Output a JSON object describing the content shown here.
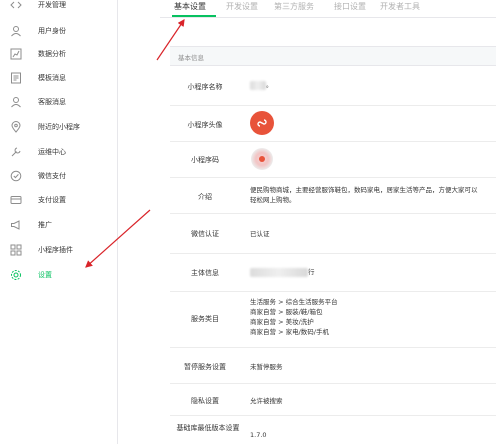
{
  "sidebar": {
    "items": [
      {
        "label": "开发管理",
        "icon": "code-icon"
      },
      {
        "label": "用户身份",
        "icon": "user-icon"
      },
      {
        "label": "数据分析",
        "icon": "chart-icon"
      },
      {
        "label": "模板消息",
        "icon": "template-icon"
      },
      {
        "label": "客服消息",
        "icon": "service-icon"
      },
      {
        "label": "附近的小程序",
        "icon": "location-icon"
      },
      {
        "label": "运维中心",
        "icon": "wrench-icon"
      },
      {
        "label": "微信支付",
        "icon": "pay-icon"
      },
      {
        "label": "支付设置",
        "icon": "pay-settings-icon"
      },
      {
        "label": "推广",
        "icon": "megaphone-icon"
      },
      {
        "label": "小程序插件",
        "icon": "plugin-icon"
      },
      {
        "label": "设置",
        "icon": "gear-icon",
        "active": true
      }
    ]
  },
  "tabs": [
    "基本设置",
    "开发设置",
    "第三方服务",
    "接口设置",
    "开发者工具"
  ],
  "panel": {
    "title": "基本信息",
    "rows": {
      "name": {
        "key": "小程序名称",
        "value_suffix": "。"
      },
      "avatar": {
        "key": "小程序头像"
      },
      "qrcode": {
        "key": "小程序码"
      },
      "intro": {
        "key": "介绍",
        "value": "便民购物商城，主要经营服饰鞋包，数码家电，居家生活等产品，方便大家可以轻松网上购物。"
      },
      "wechat_auth": {
        "key": "微信认证",
        "value": "已认证"
      },
      "subject": {
        "key": "主体信息",
        "value_suffix": "行"
      },
      "category": {
        "key": "服务类目",
        "lines": [
          "生活服务 > 综合生活服务平台",
          "商家自营 > 服装/鞋/箱包",
          "商家自营 > 美妆/洗护",
          "商家自营 > 家电/数码/手机"
        ]
      },
      "pause": {
        "key": "暂停服务设置",
        "value": "未暂停服务"
      },
      "privacy": {
        "key": "隐私设置",
        "value": "允许被搜索"
      },
      "base_lib": {
        "key": "基础库最低版本设置",
        "value": "1.7.0"
      }
    }
  },
  "colors": {
    "accent": "#07c160",
    "arrow": "#d9242a",
    "avatar": "#e8533a"
  }
}
